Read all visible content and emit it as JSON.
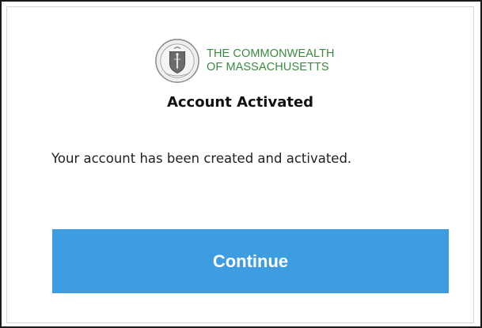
{
  "brand": {
    "line1": "THE COMMONWEALTH",
    "line2": "OF MASSACHUSETTS",
    "color": "#3a8a3e",
    "icon": "state-seal-icon"
  },
  "title": "Account Activated",
  "message": "Your account has been created and activated.",
  "continue_button": {
    "label": "Continue",
    "color": "#3d9de0"
  }
}
